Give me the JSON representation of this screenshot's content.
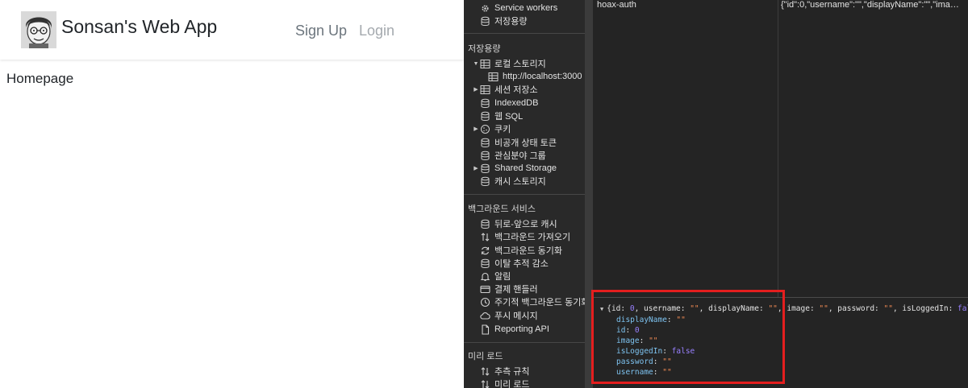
{
  "app": {
    "title": "Sonsan's Web App",
    "nav": {
      "signup": "Sign Up",
      "login": "Login"
    },
    "heading": "Homepage"
  },
  "devtools": {
    "sidebar": {
      "top_items": [
        {
          "label": "Service workers",
          "icon": "gear-icon"
        },
        {
          "label": "저장용량",
          "icon": "database-icon"
        }
      ],
      "storage_title": "저장용량",
      "storage_items": [
        {
          "label": "로컬 스토리지",
          "icon": "table-icon",
          "expanded": true
        },
        {
          "label": "http://localhost:3000",
          "icon": "table-icon",
          "selected": true
        },
        {
          "label": "세션 저장소",
          "icon": "table-icon",
          "expandable": true
        },
        {
          "label": "IndexedDB",
          "icon": "database-icon"
        },
        {
          "label": "웹 SQL",
          "icon": "database-icon"
        },
        {
          "label": "쿠키",
          "icon": "cookie-icon",
          "expandable": true
        },
        {
          "label": "비공개 상태 토큰",
          "icon": "database-icon"
        },
        {
          "label": "관심분야 그룹",
          "icon": "database-icon"
        },
        {
          "label": "Shared Storage",
          "icon": "database-icon",
          "expandable": true
        },
        {
          "label": "캐시 스토리지",
          "icon": "database-icon"
        }
      ],
      "background_title": "백그라운드 서비스",
      "background_items": [
        {
          "label": "뒤로-앞으로 캐시",
          "icon": "database-icon"
        },
        {
          "label": "백그라운드 가져오기",
          "icon": "arrows-updown-icon"
        },
        {
          "label": "백그라운드 동기화",
          "icon": "sync-icon"
        },
        {
          "label": "이탈 추적 감소",
          "icon": "database-icon"
        },
        {
          "label": "알림",
          "icon": "bell-icon"
        },
        {
          "label": "결제 핸들러",
          "icon": "card-icon"
        },
        {
          "label": "주기적 백그라운드 동기화",
          "icon": "clock-icon"
        },
        {
          "label": "푸시 메시지",
          "icon": "cloud-icon"
        },
        {
          "label": "Reporting API",
          "icon": "document-icon"
        }
      ],
      "preload_title": "미리 로드",
      "preload_items": [
        {
          "label": "추측 규칙",
          "icon": "arrows-updown-icon"
        },
        {
          "label": "미리 로드",
          "icon": "arrows-updown-icon"
        }
      ]
    },
    "table": {
      "row": {
        "key": "hoax-auth",
        "value": "{\"id\":0,\"username\":\"\",\"displayName\":\"\",\"imag..."
      }
    },
    "preview": {
      "summary_parts": [
        "{id: ",
        "0",
        ", username: ",
        "\"\"",
        ", displayName: ",
        "\"\"",
        ", image: ",
        "\"\"",
        ", password: ",
        "\"\"",
        ", isLoggedIn: ",
        "false"
      ],
      "properties": [
        {
          "key": "displayName",
          "value": "\"\"",
          "type": "string"
        },
        {
          "key": "id",
          "value": "0",
          "type": "number"
        },
        {
          "key": "image",
          "value": "\"\"",
          "type": "string"
        },
        {
          "key": "isLoggedIn",
          "value": "false",
          "type": "bool"
        },
        {
          "key": "password",
          "value": "\"\"",
          "type": "string"
        },
        {
          "key": "username",
          "value": "\"\"",
          "type": "string"
        }
      ]
    },
    "colors": {
      "highlight": "#e41e1e",
      "panel_bg": "#242424",
      "sidebar_bg": "#292929"
    }
  }
}
